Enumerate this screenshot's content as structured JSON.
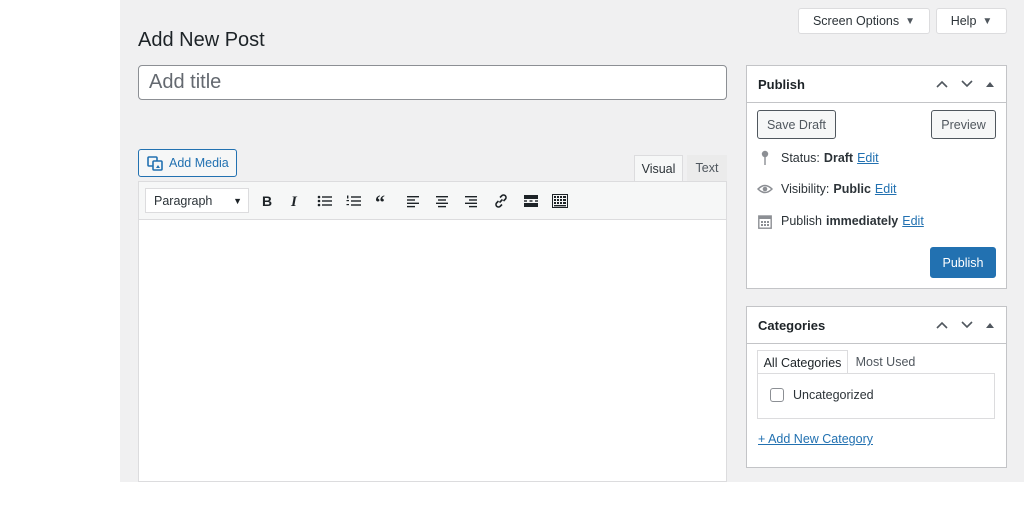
{
  "header": {
    "page_title": "Add New Post",
    "screen_options_label": "Screen Options",
    "help_label": "Help"
  },
  "title_field": {
    "placeholder": "Add title",
    "value": ""
  },
  "editor": {
    "add_media_label": "Add Media",
    "tabs": [
      {
        "label": "Visual",
        "active": true
      },
      {
        "label": "Text",
        "active": false
      }
    ],
    "format_select_value": "Paragraph",
    "toolbar_icons": [
      "bold-icon",
      "italic-icon",
      "bulleted-list-icon",
      "numbered-list-icon",
      "blockquote-icon",
      "align-left-icon",
      "align-center-icon",
      "align-right-icon",
      "link-icon",
      "read-more-icon",
      "toolbar-toggle-icon"
    ]
  },
  "publish_box": {
    "title": "Publish",
    "save_draft_label": "Save Draft",
    "preview_label": "Preview",
    "status": {
      "label": "Status:",
      "value": "Draft",
      "edit": "Edit"
    },
    "visibility": {
      "label": "Visibility:",
      "value": "Public",
      "edit": "Edit"
    },
    "schedule": {
      "label": "Publish",
      "value": "immediately",
      "edit": "Edit"
    },
    "publish_label": "Publish"
  },
  "categories_box": {
    "title": "Categories",
    "tabs": [
      {
        "label": "All Categories",
        "active": true
      },
      {
        "label": "Most Used",
        "active": false
      }
    ],
    "items": [
      {
        "label": "Uncategorized",
        "checked": false
      }
    ],
    "add_new_label": "+ Add New Category"
  },
  "colors": {
    "accent": "#2271b1",
    "background": "#f0f0f1",
    "border": "#c3c4c7"
  }
}
